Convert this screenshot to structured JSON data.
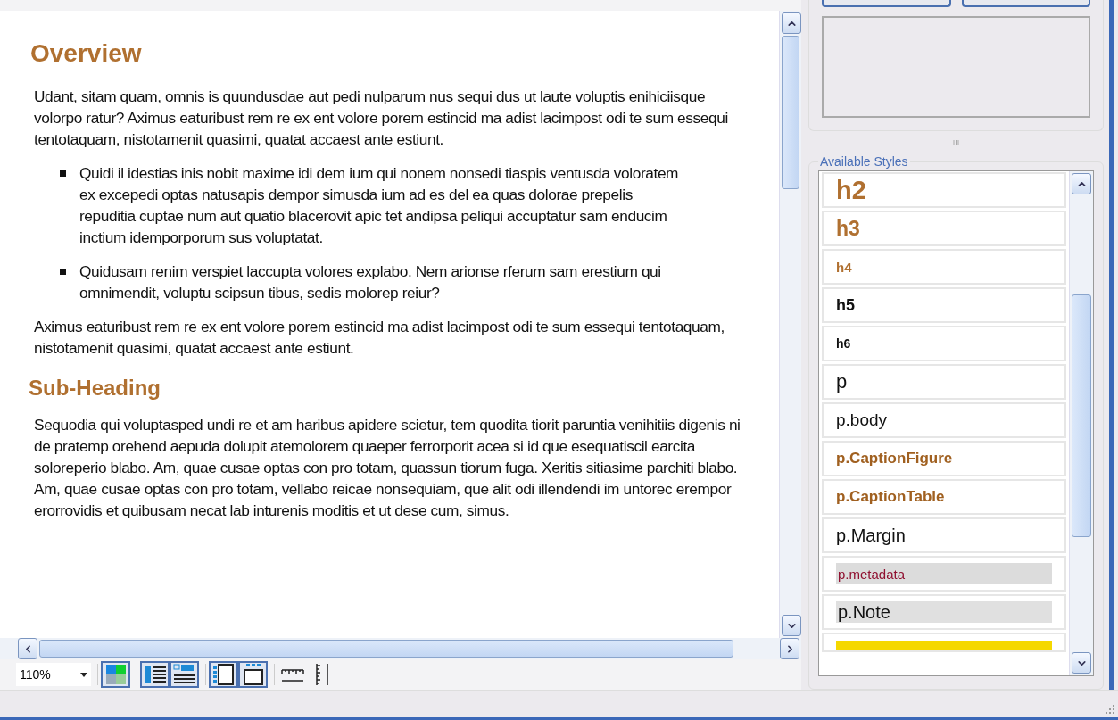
{
  "document": {
    "heading": "Overview",
    "blocks": [
      {
        "kind": "paragraph",
        "text": "Udant, sitam quam, omnis is quundusdae aut pedi nulparum nus sequi dus ut laute voluptis enihiciisque volorpo ratur? Aximus eaturibust rem re ex ent volore porem estincid ma adist lacimpost odi te sum essequi tentotaquam, nistotamenit quasimi, quatat accaest ante estiunt."
      },
      {
        "kind": "bullets",
        "items": [
          "Quidi il idestias inis nobit maxime idi dem ium qui nonem nonsedi tiaspis ventusda voloratem ex excepedi optas natusapis dempor simusda ium ad es del ea quas dolorae prepelis repuditia cuptae num aut quatio blacerovit apic tet andipsa peliqui accuptatur sam enducim inctium idemporporum sus voluptatat.",
          "Quidusam renim verspiet laccupta volores explabo. Nem arionse rferum sam erestium qui omnimendit, voluptu scipsun tibus, sedis molorep reiur?"
        ]
      },
      {
        "kind": "paragraph",
        "text": "Aximus eaturibust rem re ex ent volore porem estincid ma adist lacimpost odi te sum essequi tentotaquam, nistotamenit quasimi, quatat accaest ante estiunt."
      },
      {
        "kind": "subheading",
        "text": "Sub-Heading"
      },
      {
        "kind": "paragraph",
        "text": "Sequodia qui voluptasped undi re et am haribus apidere scietur, tem quodita tiorit paruntia venihitiis digenis ni de pratemp orehend aepuda dolupit atemolorem quaeper ferrorporit acea si id que esequatiscil earcita soloreperio blabo. Am, quae cusae optas con pro totam, quassun tiorum fuga. Xeritis sitiasime parchiti blabo. Am, quae cusae optas con pro totam, vellabo reicae nonsequiam, que alit odi illendendi im untorec erempor erorrovidis et quibusam necat lab inturenis moditis et ut dese cum, simus."
      }
    ]
  },
  "toolbar": {
    "zoom": "110%",
    "groups": [
      [
        {
          "kind": "colors",
          "pressed": true
        }
      ],
      [
        {
          "kind": "side-label",
          "pressed": true
        },
        {
          "kind": "top-label",
          "pressed": true
        }
      ],
      [
        {
          "kind": "side-grid",
          "pressed": true
        },
        {
          "kind": "top-grid",
          "pressed": true
        }
      ],
      [
        {
          "kind": "h-ruler",
          "pressed": false
        },
        {
          "kind": "v-ruler",
          "pressed": false
        }
      ]
    ]
  },
  "styles_panel": {
    "title": "Available Styles",
    "items": [
      {
        "kind": "h2",
        "label": "h2"
      },
      {
        "kind": "h3",
        "label": "h3"
      },
      {
        "kind": "h4",
        "label": "h4"
      },
      {
        "kind": "h5",
        "label": "h5"
      },
      {
        "kind": "h6",
        "label": "h6"
      },
      {
        "kind": "p",
        "label": "p"
      },
      {
        "kind": "body",
        "label": "p.body"
      },
      {
        "kind": "caption",
        "label": "p.CaptionFigure"
      },
      {
        "kind": "caption",
        "label": "p.CaptionTable"
      },
      {
        "kind": "margin",
        "label": "p.Margin"
      },
      {
        "kind": "metadata",
        "label": "p.metadata"
      },
      {
        "kind": "note",
        "label": "p.Note"
      },
      {
        "kind": "highlight"
      }
    ]
  }
}
